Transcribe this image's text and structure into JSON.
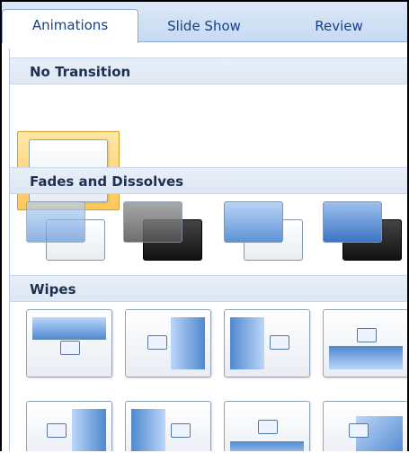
{
  "tabs": [
    {
      "label": "Animations",
      "active": true
    },
    {
      "label": "Slide Show",
      "active": false
    },
    {
      "label": "Review",
      "active": false
    }
  ],
  "sections": [
    {
      "title": "No Transition"
    },
    {
      "title": "Fades and Dissolves"
    },
    {
      "title": "Wipes"
    }
  ],
  "transitions": {
    "no_transition": [
      "no-transition"
    ],
    "fades": [
      "fade-smoothly",
      "fade-through-black",
      "dissolve",
      "cut-through-black"
    ],
    "wipes": [
      "wipe-down",
      "wipe-left",
      "wipe-right",
      "wipe-up",
      "wipe-left-2",
      "wipe-right-2",
      "wipe-up-2",
      "wipe-diagonal"
    ]
  },
  "colors": {
    "accent": "#15428b",
    "selected_border": "#d99b2b"
  }
}
